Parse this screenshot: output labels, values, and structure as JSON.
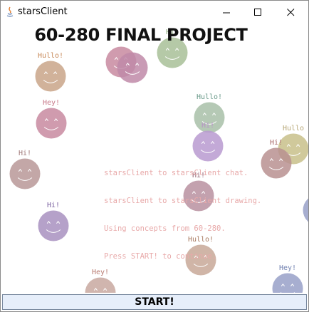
{
  "window": {
    "title": "starsClient",
    "controls": {
      "minimize": "minimize-icon",
      "maximize": "maximize-icon",
      "close": "close-icon"
    }
  },
  "canvas": {
    "headline": "60-280 FINAL PROJECT",
    "info_lines": [
      "starsClient to starsClient chat.",
      "starsClient to starsClient drawing.",
      "Using concepts from 60-280.",
      "Press START! to continue."
    ],
    "stars": [
      {
        "label": "Hullo!",
        "color": "#c9a488",
        "label_color": "#c88a5a"
      },
      {
        "label": "",
        "color": "#c88aa0",
        "label_color": "#c88aa0"
      },
      {
        "label": "",
        "color": "#c08aa8",
        "label_color": "#c08aa8"
      },
      {
        "label": "Hi!",
        "color": "#a8c098",
        "label_color": "#8aa87a"
      },
      {
        "label": "Hey!",
        "color": "#c88aa0",
        "label_color": "#c87a8a"
      },
      {
        "label": "Hullo!",
        "color": "#a8c0a8",
        "label_color": "#6a9a8a"
      },
      {
        "label": "Hi!",
        "color": "#b89ad0",
        "label_color": "#b890c8"
      },
      {
        "label": "Hullo",
        "color": "#c8c08a",
        "label_color": "#b8a878"
      },
      {
        "label": "Hi!",
        "color": "#b89090",
        "label_color": "#a86a6a"
      },
      {
        "label": "Hi!",
        "color": "#b89898",
        "label_color": "#a07878"
      },
      {
        "label": "Hi!",
        "color": "#b890a0",
        "label_color": "#906070"
      },
      {
        "label": "Hi!",
        "color": "#a890c0",
        "label_color": "#7a60a0"
      },
      {
        "label": "Hullo!",
        "color": "#c8a898",
        "label_color": "#a87a60"
      },
      {
        "label": "Hey!",
        "color": "#c8a8a0",
        "label_color": "#b87a70"
      },
      {
        "label": "Hey!",
        "color": "#98a0c8",
        "label_color": "#7080b0"
      },
      {
        "label": "",
        "color": "#98a0c8",
        "label_color": "#98a0c8"
      }
    ]
  },
  "start_button": {
    "label": "START!"
  }
}
